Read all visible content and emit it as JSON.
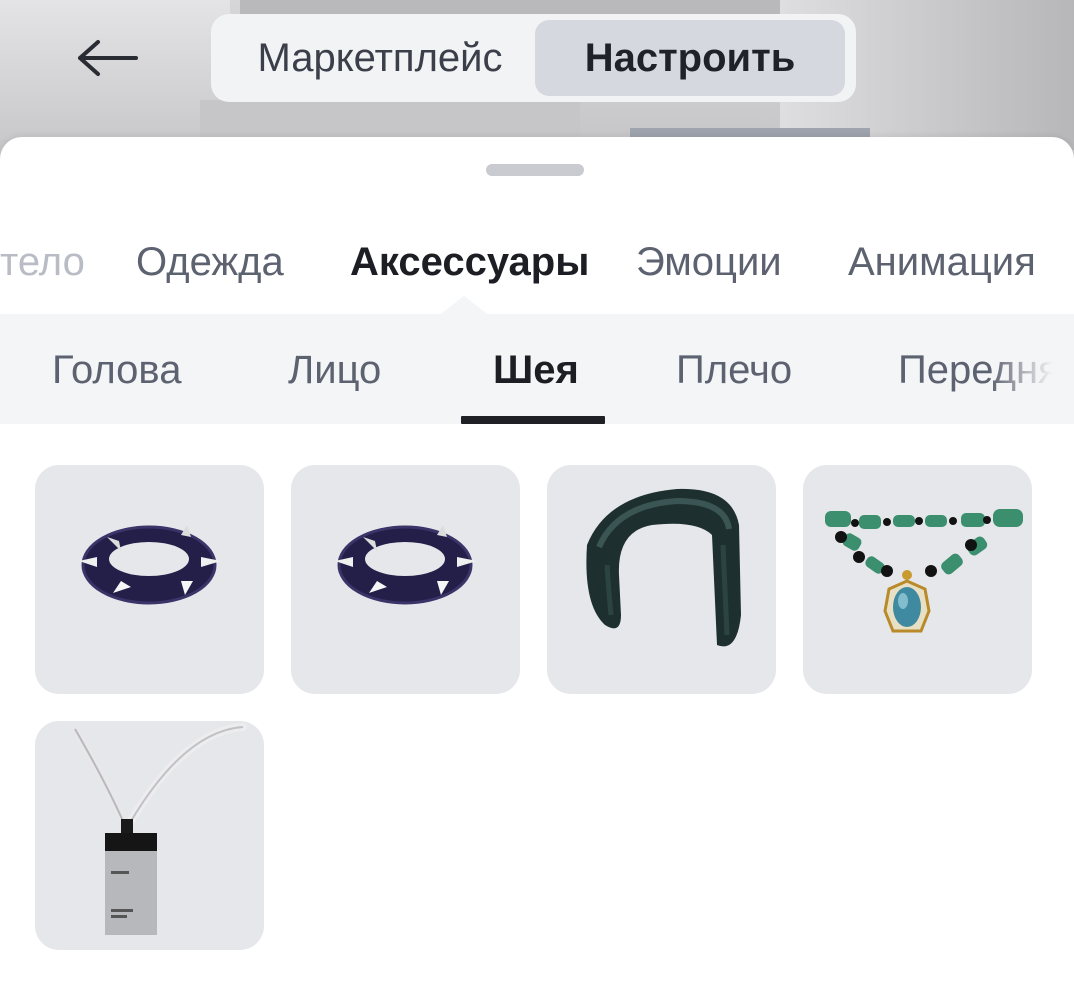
{
  "header": {
    "back_icon": "arrow-left-icon",
    "segments": [
      {
        "label": "Маркетплейс",
        "selected": false
      },
      {
        "label": "Настроить",
        "selected": true
      }
    ]
  },
  "tabs": [
    {
      "label": "Тело",
      "visible_text": "тело",
      "active": false
    },
    {
      "label": "Одежда",
      "active": false
    },
    {
      "label": "Аксессуары",
      "active": true
    },
    {
      "label": "Эмоции",
      "active": false
    },
    {
      "label": "Анимация",
      "active": false
    }
  ],
  "subtabs": [
    {
      "label": "Голова",
      "active": false
    },
    {
      "label": "Лицо",
      "active": false
    },
    {
      "label": "Шея",
      "active": true
    },
    {
      "label": "Плечо",
      "active": false
    },
    {
      "label": "Передня",
      "active": false
    }
  ],
  "items": [
    {
      "icon": "spiked-collar-icon"
    },
    {
      "icon": "spiked-collar-icon"
    },
    {
      "icon": "scarf-icon"
    },
    {
      "icon": "jade-necklace-icon"
    },
    {
      "icon": "lanyard-badge-icon"
    }
  ],
  "colors": {
    "accent_dark": "#1f2026",
    "segment_selected": "#d5d8de",
    "tile_bg": "#e6e7eb",
    "subbar_bg": "#f4f5f7"
  }
}
